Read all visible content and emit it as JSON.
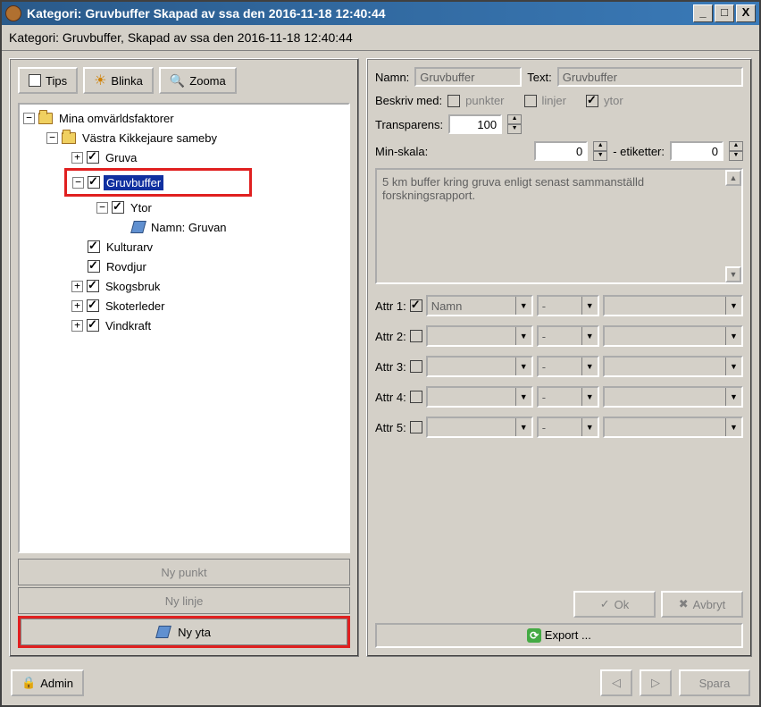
{
  "window": {
    "title": "Kategori: Gruvbuffer Skapad av ssa den 2016-11-18 12:40:44",
    "subheader": "Kategori: Gruvbuffer, Skapad av ssa den 2016-11-18 12:40:44"
  },
  "toolbar": {
    "tips": "Tips",
    "blinka": "Blinka",
    "zooma": "Zooma"
  },
  "tree": {
    "root": "Mina omvärldsfaktorer",
    "sameby": "Västra Kikkejaure sameby",
    "gruva": "Gruva",
    "gruvbuffer": "Gruvbuffer",
    "ytor": "Ytor",
    "namn_gruvan": "Namn: Gruvan",
    "kulturarv": "Kulturarv",
    "rovdjur": "Rovdjur",
    "skogsbruk": "Skogsbruk",
    "skoterleder": "Skoterleder",
    "vindkraft": "Vindkraft"
  },
  "newbtns": {
    "punkt": "Ny punkt",
    "linje": "Ny linje",
    "yta": "Ny yta"
  },
  "form": {
    "namn_lbl": "Namn:",
    "namn_val": "Gruvbuffer",
    "text_lbl": "Text:",
    "text_val": "Gruvbuffer",
    "beskriv_lbl": "Beskriv med:",
    "punkter": "punkter",
    "linjer": "linjer",
    "ytor": "ytor",
    "transparens_lbl": "Transparens:",
    "transparens_val": "100",
    "minskala_lbl": "Min-skala:",
    "minskala_val": "0",
    "etiketter_lbl": "- etiketter:",
    "etiketter_val": "0",
    "description": "5 km buffer kring gruva enligt senast sammanställd forskningsrapport."
  },
  "attrs": {
    "a1": "Attr 1:",
    "a2": "Attr 2:",
    "a3": "Attr 3:",
    "a4": "Attr 4:",
    "a5": "Attr 5:",
    "a1_val": "Namn",
    "dash": "-"
  },
  "buttons": {
    "ok": "Ok",
    "avbryt": "Avbryt",
    "export": "Export ...",
    "admin": "Admin",
    "spara": "Spara"
  }
}
